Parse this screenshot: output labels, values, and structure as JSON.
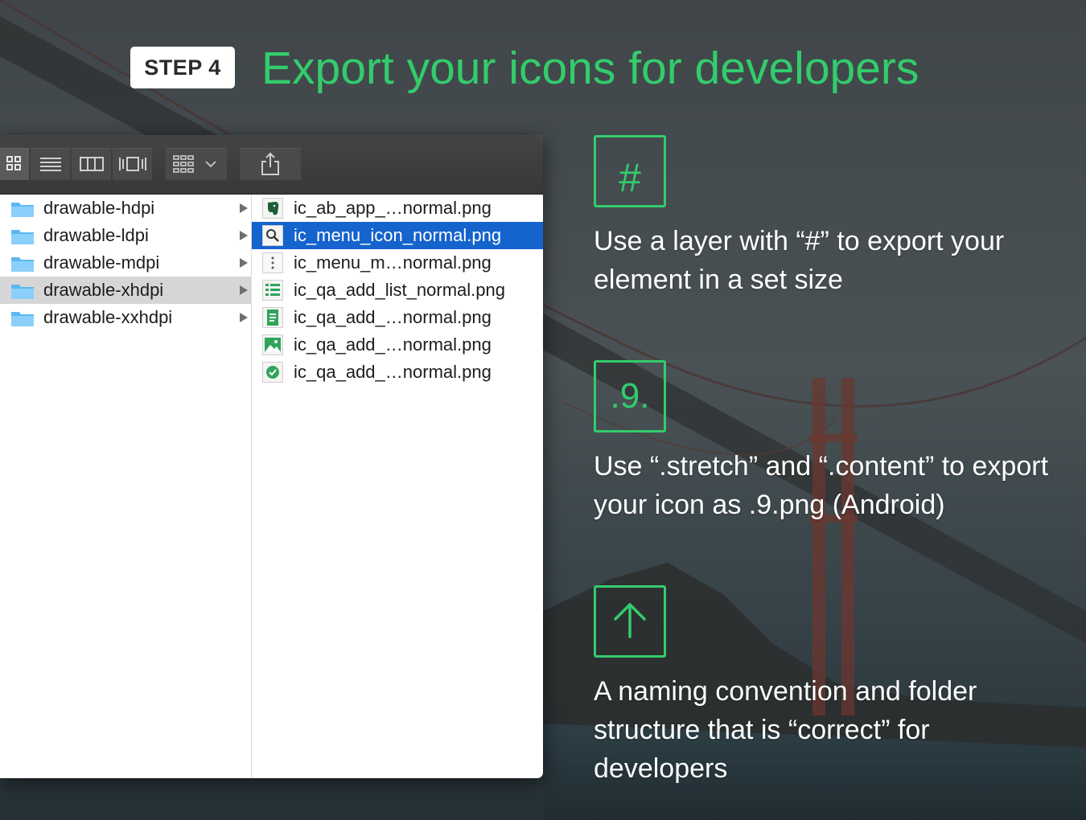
{
  "step": {
    "badge": "STEP 4",
    "title": "Export your icons for developers"
  },
  "colors": {
    "accent": "#33cc6c",
    "selection": "#1563cc",
    "folder": "#5cb8f2",
    "toolbar": "#3d3d3d"
  },
  "toolbar": {
    "buttons": [
      {
        "icon": "icon-view-icon"
      },
      {
        "icon": "list-view-icon"
      },
      {
        "icon": "column-view-icon"
      },
      {
        "icon": "cover-flow-icon"
      },
      {
        "icon": "arrange-menu-icon"
      },
      {
        "icon": "share-icon"
      }
    ]
  },
  "folders": [
    {
      "name": "drawable-hdpi",
      "selected": false
    },
    {
      "name": "drawable-ldpi",
      "selected": false
    },
    {
      "name": "drawable-mdpi",
      "selected": false
    },
    {
      "name": "drawable-xhdpi",
      "selected": true
    },
    {
      "name": "drawable-xxhdpi",
      "selected": false
    }
  ],
  "files": [
    {
      "name": "ic_ab_app_…normal.png",
      "icon": "elephant-logo-icon",
      "selected": false
    },
    {
      "name": "ic_menu_icon_normal.png",
      "icon": "magnifier-icon",
      "selected": true
    },
    {
      "name": "ic_menu_m…normal.png",
      "icon": "overflow-dots-icon",
      "selected": false
    },
    {
      "name": "ic_qa_add_list_normal.png",
      "icon": "checklist-icon",
      "selected": false
    },
    {
      "name": "ic_qa_add_…normal.png",
      "icon": "note-icon",
      "selected": false
    },
    {
      "name": "ic_qa_add_…normal.png",
      "icon": "image-icon",
      "selected": false
    },
    {
      "name": "ic_qa_add_…normal.png",
      "icon": "check-badge-icon",
      "selected": false
    }
  ],
  "features": [
    {
      "symbol": "#",
      "text": "Use a layer with “#” to export your element in a set size"
    },
    {
      "symbol": ".9.",
      "text": "Use “.stretch” and “.content” to export your icon as .9.png (Android)"
    },
    {
      "symbol": "↑",
      "icon": "up-arrow-icon",
      "text": "A naming convention and folder structure that is “correct” for developers"
    }
  ]
}
